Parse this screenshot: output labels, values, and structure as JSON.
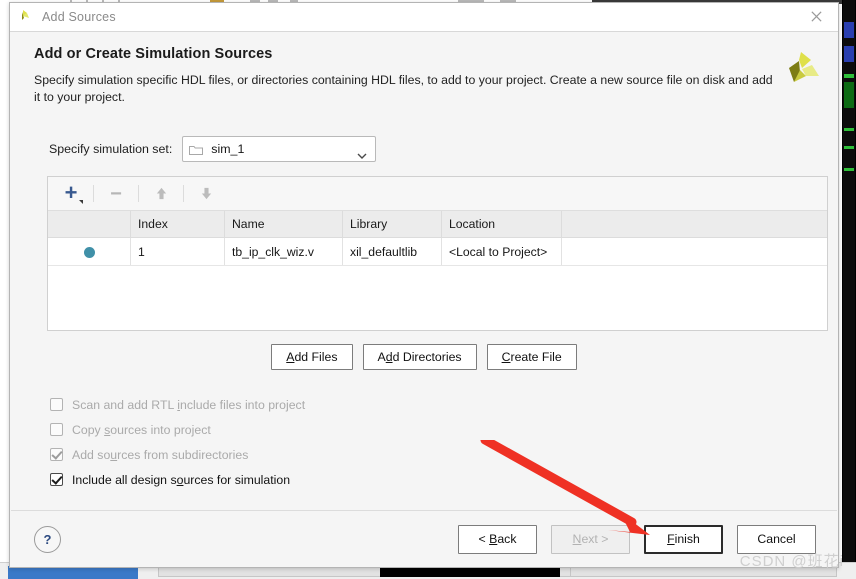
{
  "window": {
    "title": "Add Sources",
    "title_icon": "xilinx-logo-icon",
    "close_icon": "close-icon"
  },
  "header": {
    "title": "Add or Create Simulation Sources",
    "description": "Specify simulation specific HDL files, or directories containing HDL files, to add to your project. Create a new source file on disk and add it to your project.",
    "logo_icon": "xilinx-pinwheel-logo"
  },
  "simulation_set": {
    "label": "Specify simulation set:",
    "value": "sim_1",
    "folder_icon": "folder-icon",
    "caret_icon": "chevron-down-icon"
  },
  "files_toolbar": {
    "add_icon": "plus-icon",
    "add_dropdown_icon": "caret-down-icon",
    "remove_icon": "minus-icon",
    "move_up_icon": "arrow-up-icon",
    "move_down_icon": "arrow-down-icon"
  },
  "files_table": {
    "columns": [
      "",
      "Index",
      "Name",
      "Library",
      "Location",
      ""
    ],
    "rows": [
      {
        "status_dot": "filled-dot",
        "index": "1",
        "name": "tb_ip_clk_wiz.v",
        "library": "xil_defaultlib",
        "location": "<Local to Project>"
      }
    ]
  },
  "source_buttons": [
    {
      "prefix": "",
      "mnemonic": "A",
      "suffix": "dd Files"
    },
    {
      "prefix": "A",
      "mnemonic": "d",
      "suffix": "d Directories"
    },
    {
      "prefix": "",
      "mnemonic": "C",
      "suffix": "reate File"
    }
  ],
  "options": [
    {
      "prefix": "Scan and add RTL ",
      "mnemonic": "i",
      "suffix": "nclude files into project",
      "checked": false,
      "enabled": false
    },
    {
      "prefix": "Copy ",
      "mnemonic": "s",
      "suffix": "ources into project",
      "checked": false,
      "enabled": false
    },
    {
      "prefix": "Add so",
      "mnemonic": "u",
      "suffix": "rces from subdirectories",
      "checked": true,
      "enabled": false
    },
    {
      "prefix": "Include all design s",
      "mnemonic": "o",
      "suffix": "urces for simulation",
      "checked": true,
      "enabled": true
    }
  ],
  "footer": {
    "help_label": "?",
    "buttons": [
      {
        "prefix": "< ",
        "mnemonic": "B",
        "suffix": "ack",
        "state": "normal"
      },
      {
        "prefix": "",
        "mnemonic": "N",
        "suffix": "ext >",
        "state": "disabled"
      },
      {
        "prefix": "",
        "mnemonic": "F",
        "suffix": "inish",
        "state": "focused"
      },
      {
        "prefix": "Cancel",
        "mnemonic": "",
        "suffix": "",
        "state": "normal"
      }
    ]
  },
  "annotation": {
    "arrow_color": "#ef3124",
    "arrow_target": "finish-button"
  },
  "watermark": {
    "text": "CSDN @班花i"
  },
  "colors": {
    "accent_blue": "#38598f",
    "dot_teal": "#4090a8",
    "dialog_bg": "#f5f5f5",
    "logo_olive": "#7d7d14",
    "logo_yellow": "#dfe04a"
  }
}
